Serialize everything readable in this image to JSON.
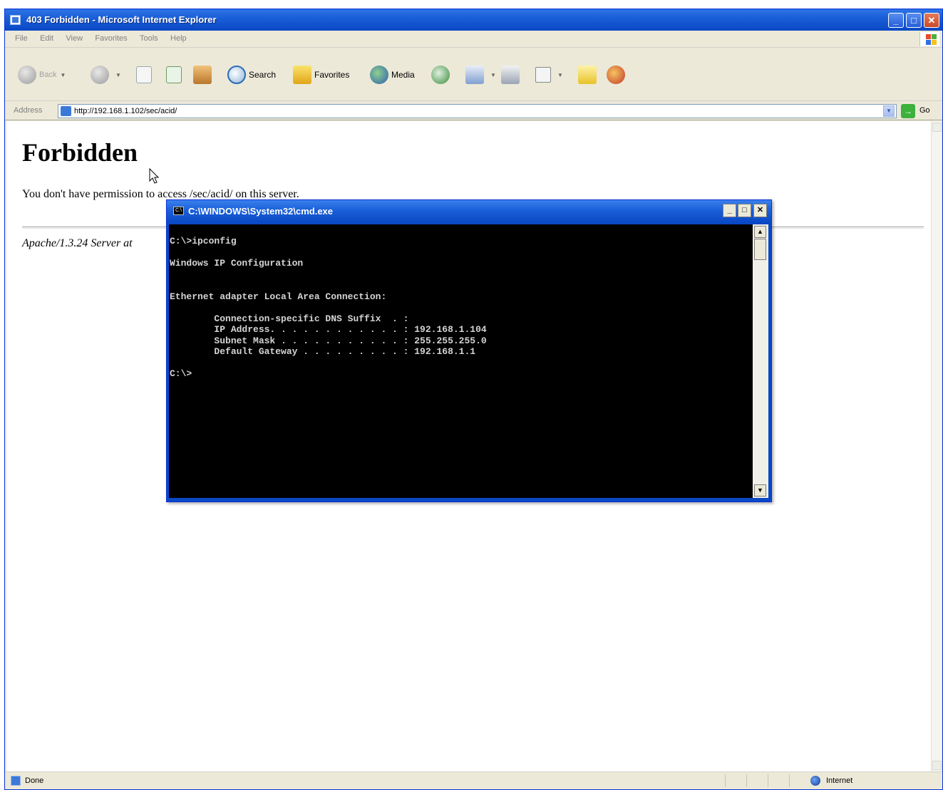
{
  "browser": {
    "title": "403 Forbidden - Microsoft Internet Explorer",
    "menu": [
      "File",
      "Edit",
      "View",
      "Favorites",
      "Tools",
      "Help"
    ],
    "toolbar": {
      "back_label": "Back",
      "search_label": "Search",
      "favorites_label": "Favorites",
      "media_label": "Media"
    },
    "address": {
      "label": "Address",
      "url": "http://192.168.1.102/sec/acid/",
      "go_label": "Go"
    },
    "status": {
      "text": "Done",
      "zone": "Internet"
    }
  },
  "page": {
    "heading": "Forbidden",
    "message": "You don't have permission to access /sec/acid/ on this server.",
    "server_signature": "Apache/1.3.24 Server at"
  },
  "cmd": {
    "title": "C:\\WINDOWS\\System32\\cmd.exe",
    "output": "C:\\>ipconfig\n\nWindows IP Configuration\n\n\nEthernet adapter Local Area Connection:\n\n        Connection-specific DNS Suffix  . :\n        IP Address. . . . . . . . . . . . : 192.168.1.104\n        Subnet Mask . . . . . . . . . . . : 255.255.255.0\n        Default Gateway . . . . . . . . . : 192.168.1.1\n\nC:\\>"
  }
}
